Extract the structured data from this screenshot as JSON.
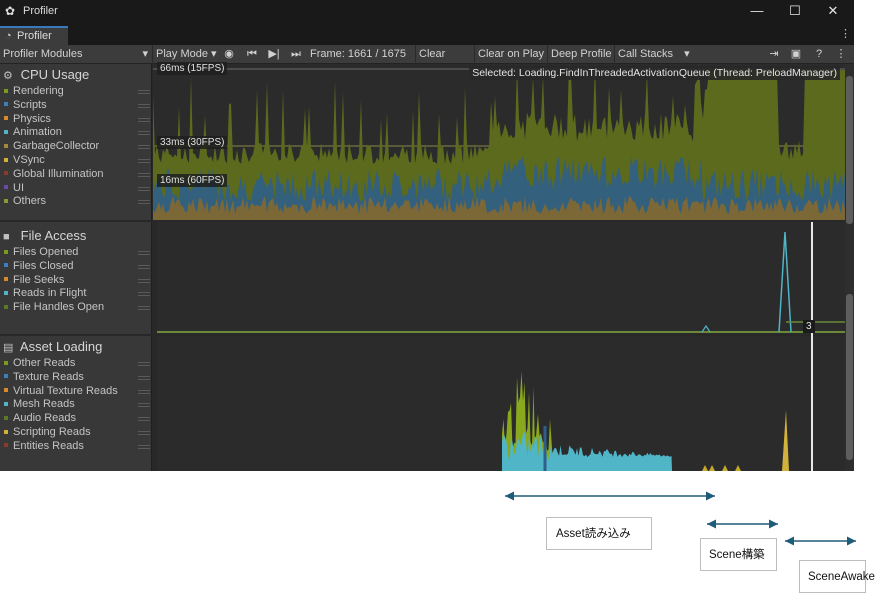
{
  "window": {
    "title": "Profiler",
    "tab_label": "Profiler",
    "minimize_glyph": "—",
    "maximize_glyph": "☐",
    "close_glyph": "✕",
    "tab_menu_glyph": "⋮"
  },
  "toolbar": {
    "modules_label": "Profiler Modules",
    "play_mode_label": "Play Mode",
    "frame_label": "Frame: 1661 / 1675",
    "clear_label": "Clear",
    "clear_on_play_label": "Clear on Play",
    "deep_profile_label": "Deep Profile",
    "call_stacks_label": "Call Stacks",
    "dropdown_glyph": "▾",
    "more_glyph": "⋮"
  },
  "cpu": {
    "title": "CPU Usage",
    "legend": [
      {
        "label": "Rendering",
        "color": "#7a9a1e"
      },
      {
        "label": "Scripts",
        "color": "#3c7fbf"
      },
      {
        "label": "Physics",
        "color": "#d98a2a"
      },
      {
        "label": "Animation",
        "color": "#4fb5c7"
      },
      {
        "label": "GarbageCollector",
        "color": "#a28a3a"
      },
      {
        "label": "VSync",
        "color": "#d2b23c"
      },
      {
        "label": "Global Illumination",
        "color": "#8a3a2a"
      },
      {
        "label": "UI",
        "color": "#6a4aa2"
      },
      {
        "label": "Others",
        "color": "#8a9a3a"
      }
    ],
    "axis_labels": [
      "66ms (15FPS)",
      "33ms (30FPS)",
      "16ms (60FPS)"
    ],
    "selected_text": "Selected: Loading.FindInThreadedActivationQueue (Thread: PreloadManager)"
  },
  "file_access": {
    "title": "File Access",
    "legend": [
      {
        "label": "Files Opened",
        "color": "#7a9a1e"
      },
      {
        "label": "Files Closed",
        "color": "#3c7fbf"
      },
      {
        "label": "File Seeks",
        "color": "#d98a2a"
      },
      {
        "label": "Reads in Flight",
        "color": "#4fb5c7"
      },
      {
        "label": "File Handles Open",
        "color": "#5a7a2a"
      }
    ],
    "value_tag": "3"
  },
  "asset_loading": {
    "title": "Asset Loading",
    "legend": [
      {
        "label": "Other Reads",
        "color": "#7a9a1e"
      },
      {
        "label": "Texture Reads",
        "color": "#3c7fbf"
      },
      {
        "label": "Virtual Texture Reads",
        "color": "#d98a2a"
      },
      {
        "label": "Mesh Reads",
        "color": "#4fb5c7"
      },
      {
        "label": "Audio Reads",
        "color": "#5a7a2a"
      },
      {
        "label": "Scripting Reads",
        "color": "#d2b23c"
      },
      {
        "label": "Entities Reads",
        "color": "#8a3a2a"
      }
    ]
  },
  "annotations": {
    "asset_loading": "Asset読み込み",
    "scene_build": "Scene構築",
    "scene_awake": "SceneAwake",
    "arrow_color": "#1f5c7a"
  }
}
